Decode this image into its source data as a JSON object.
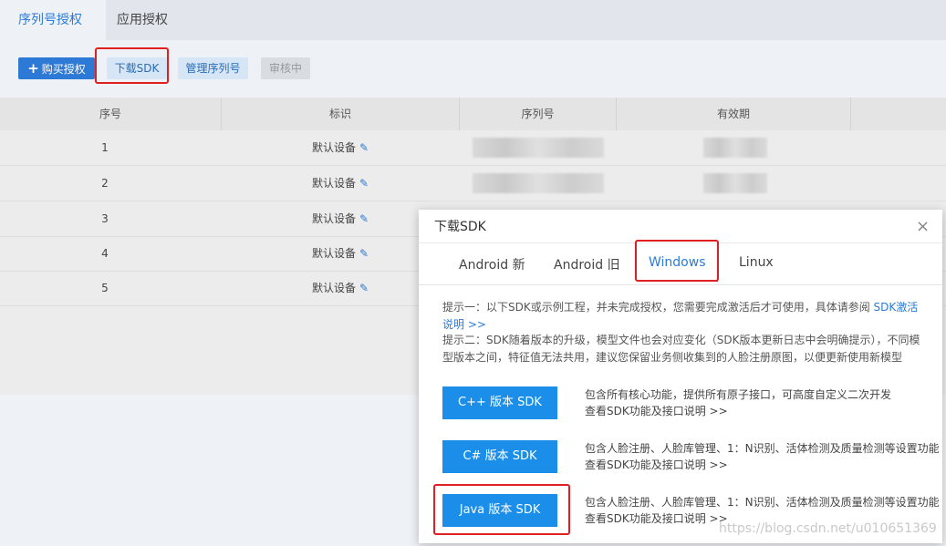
{
  "top_tabs": [
    "序列号授权",
    "应用授权"
  ],
  "toolbar": {
    "buy": "购买授权",
    "download": "下载SDK",
    "manage": "管理序列号",
    "review": "审核中",
    "plus_icon": "+"
  },
  "table": {
    "headers": [
      "序号",
      "标识",
      "序列号",
      "有效期"
    ],
    "rows": [
      {
        "index": "1",
        "label": "默认设备"
      },
      {
        "index": "2",
        "label": "默认设备"
      },
      {
        "index": "3",
        "label": "默认设备"
      },
      {
        "index": "4",
        "label": "默认设备"
      },
      {
        "index": "5",
        "label": "默认设备"
      }
    ],
    "edit_icon": "✎"
  },
  "modal": {
    "title": "下载SDK",
    "close": "×",
    "tabs": [
      "Android 新",
      "Android 旧",
      "Windows",
      "Linux"
    ],
    "hint1_text": "提示一：以下SDK或示例工程，并未完成授权，您需要完成激活后才可使用，具体请参阅 ",
    "hint1_link": "SDK激活说明 >>",
    "hint2": "提示二：SDK随着版本的升级，模型文件也会对应变化（SDK版本更新日志中会明确提示），不同模型版本之间，特征值无法共用，建议您保留业务侧收集到的人脸注册原图，以便更新使用新模型",
    "sdks": [
      {
        "button": "C++ 版本 SDK",
        "desc": "包含所有核心功能，提供所有原子接口，可高度自定义二次开发",
        "link": "查看SDK功能及接口说明 >>"
      },
      {
        "button": "C# 版本 SDK",
        "desc": "包含人脸注册、人脸库管理、1：N识别、活体检测及质量检测等设置功能",
        "link": "查看SDK功能及接口说明 >>"
      },
      {
        "button": "Java 版本 SDK",
        "desc": "包含人脸注册、人脸库管理、1：N识别、活体检测及质量检测等设置功能",
        "link": "查看SDK功能及接口说明 >>"
      }
    ]
  },
  "watermark": "https://blog.csdn.net/u010651369"
}
